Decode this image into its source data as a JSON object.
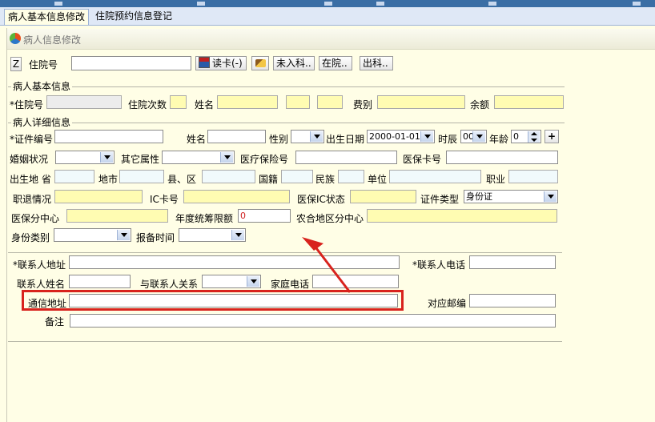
{
  "tabs": [
    {
      "label": "病人基本信息修改",
      "active": true
    },
    {
      "label": "住院预约信息登记",
      "active": false
    }
  ],
  "panel_title": "病人信息修改",
  "toolbar": {
    "z_label": "Z",
    "admission_no_label": "住院号",
    "admission_no_value": "",
    "read_card_label": "读卡(-)",
    "not_admitted_label": "未入科..",
    "in_hospital_label": "在院..",
    "discharged_label": "出科.."
  },
  "basic_info": {
    "group_label": "病人基本信息",
    "admission_no_label": "*住院号",
    "admission_count_label": "住院次数",
    "name_label": "姓名",
    "fee_type_label": "费别",
    "balance_label": "余额"
  },
  "detail_info": {
    "group_label": "病人详细信息",
    "id_no_label": "*证件编号",
    "name_label": "姓名",
    "gender_label": "性别",
    "birth_date_label": "出生日期",
    "birth_date_value": "2000-01-01",
    "hour_label": "时辰",
    "hour_value": "00",
    "age_label": "年龄",
    "age_value": "0",
    "plus_label": "+",
    "marital_label": "婚姻状况",
    "other_attr_label": "其它属性",
    "insurance_no_label": "医疗保险号",
    "insurance_card_label": "医保卡号",
    "birthplace_label": "出生地 省",
    "city_label": "地市",
    "county_label": "县、区",
    "nationality_label": "国籍",
    "ethnicity_label": "民族",
    "employer_label": "单位",
    "occupation_label": "职业",
    "retirement_label": "职退情况",
    "ic_card_label": "IC卡号",
    "insurance_ic_status_label": "医保IC状态",
    "id_type_label": "证件类型",
    "id_type_value": "身份证",
    "insurance_center_label": "医保分中心",
    "annual_limit_label": "年度统筹限额",
    "annual_limit_value": "0",
    "rural_center_label": "农合地区分中心",
    "identity_type_label": "身份类别",
    "report_time_label": "报备时间"
  },
  "contact": {
    "address_label": "*联系人地址",
    "phone_label": "*联系人电话",
    "name_label": "联系人姓名",
    "relation_label": "与联系人关系",
    "home_phone_label": "家庭电话",
    "mail_address_label": "通信地址",
    "postcode_label": "对应邮编",
    "remark_label": "备注"
  },
  "colors": {
    "highlight": "#d8231d",
    "required_field": "#fffcb2",
    "background": "#fffee6"
  }
}
